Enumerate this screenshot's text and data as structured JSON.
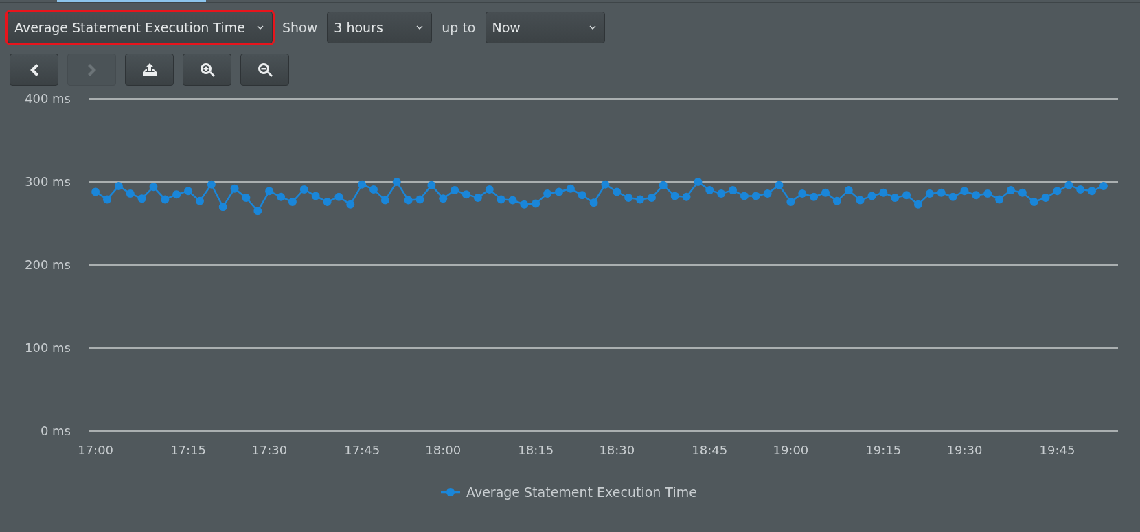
{
  "tab_strip": {
    "active_tab": {
      "selected": true
    }
  },
  "metric_select": {
    "value": "Average Statement Execution Time",
    "highlighted": true
  },
  "range": {
    "show_label": "Show",
    "duration": "3 hours",
    "upto_label": "up to",
    "end": "Now"
  },
  "toolbar": [
    {
      "kind": "back",
      "disabled": false
    },
    {
      "kind": "forward",
      "disabled": true
    },
    {
      "kind": "export",
      "disabled": false
    },
    {
      "kind": "zoom-in",
      "disabled": false
    },
    {
      "kind": "zoom-out",
      "disabled": false
    }
  ],
  "chart_data": {
    "type": "line",
    "categories": [
      "17:00",
      null,
      null,
      null,
      null,
      null,
      null,
      null,
      "17:15",
      null,
      null,
      null,
      null,
      null,
      null,
      "17:30",
      null,
      null,
      null,
      null,
      null,
      null,
      null,
      "17:45",
      null,
      null,
      null,
      null,
      null,
      null,
      "18:00",
      null,
      null,
      null,
      null,
      null,
      null,
      null,
      "18:15",
      null,
      null,
      null,
      null,
      null,
      null,
      "18:30",
      null,
      null,
      null,
      null,
      null,
      null,
      null,
      "18:45",
      null,
      null,
      null,
      null,
      null,
      null,
      "19:00",
      null,
      null,
      null,
      null,
      null,
      null,
      null,
      "19:15",
      null,
      null,
      null,
      null,
      null,
      null,
      "19:30",
      null,
      null,
      null,
      null,
      null,
      null,
      null,
      "19:45",
      null,
      null,
      null,
      null
    ],
    "series": [
      {
        "name": "Average Statement Execution Time",
        "color": "#1a86d9",
        "marker": "circle",
        "values": [
          288,
          279,
          295,
          286,
          280,
          294,
          279,
          285,
          289,
          277,
          297,
          270,
          292,
          281,
          265,
          289,
          282,
          276,
          291,
          283,
          276,
          282,
          273,
          297,
          291,
          278,
          300,
          278,
          279,
          296,
          280,
          290,
          285,
          281,
          291,
          279,
          278,
          273,
          274,
          286,
          288,
          292,
          284,
          275,
          297,
          288,
          281,
          279,
          281,
          296,
          283,
          282,
          300,
          290,
          286,
          290,
          283,
          283,
          286,
          296,
          276,
          286,
          282,
          287,
          277,
          290,
          278,
          283,
          287,
          281,
          284,
          273,
          286,
          287,
          282,
          289,
          284,
          286,
          279,
          290,
          287,
          276,
          281,
          289,
          296,
          291,
          289,
          295
        ]
      }
    ],
    "ylim": [
      0,
      400
    ],
    "grid": true,
    "yticks": [
      {
        "value": 0,
        "label": "0 ms"
      },
      {
        "value": 100,
        "label": "100 ms"
      },
      {
        "value": 200,
        "label": "200 ms"
      },
      {
        "value": 300,
        "label": "300 ms"
      },
      {
        "value": 400,
        "label": "400 ms"
      }
    ]
  }
}
